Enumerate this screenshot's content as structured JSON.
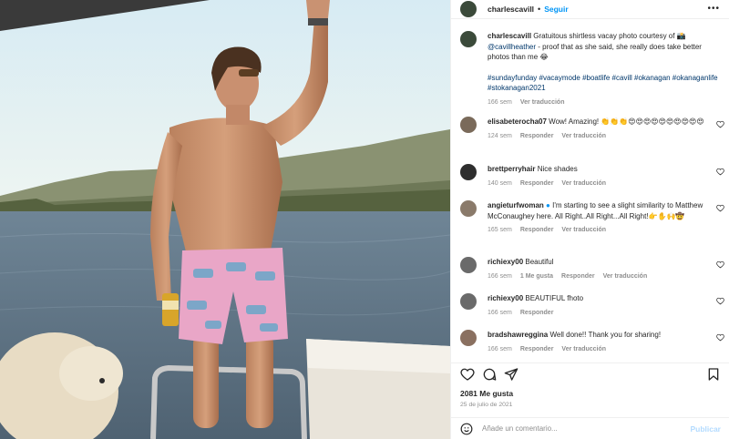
{
  "post": {
    "username": "charlescavill",
    "follow_label": "Seguir",
    "more_label": "•••",
    "caption": {
      "username": "charlescavill",
      "text": "Gratuitous shirtless vacay photo courtesy of 📸 ",
      "mention": "@cavillheather",
      "text2": " - proof that as she said, she really does take better photos than me 😂",
      "hashtags": "#sundayfunday #vacaymode #boatlife #cavill #okanagan #okanaganlife #stokanagan2021",
      "time": "166 sem",
      "translate": "Ver traducción"
    },
    "comments": [
      {
        "user": "elisabeterocha07",
        "text": "Wow! Amazing! 👏👏👏😍😍😍😍😍😍😍😍😍😍",
        "time": "124 sem",
        "reply": "Responder",
        "translate": "Ver traducción",
        "likes": ""
      },
      {
        "user": "brettperryhair",
        "text": "Nice shades",
        "time": "140 sem",
        "reply": "Responder",
        "translate": "Ver traducción",
        "likes": ""
      },
      {
        "user": "angieturfwoman",
        "text": "I'm starting to see a slight similarity to Matthew McConaughey here. All Right..All Right...All Right!👉✋🙌🤠",
        "time": "165 sem",
        "reply": "Responder",
        "translate": "Ver traducción",
        "likes": ""
      },
      {
        "user": "richiexy00",
        "text": "Beautiful",
        "time": "166 sem",
        "reply": "Responder",
        "translate": "Ver traducción",
        "likes": "1 Me gusta"
      },
      {
        "user": "richiexy00",
        "text": "BEAUTIFUL fhoto",
        "time": "166 sem",
        "reply": "Responder",
        "translate": "",
        "likes": ""
      },
      {
        "user": "bradshawreggina",
        "text": "Well done!! Thank you for sharing!",
        "time": "166 sem",
        "reply": "Responder",
        "translate": "Ver traducción",
        "likes": ""
      }
    ],
    "likes": "2081 Me gusta",
    "date": "25 de julio de 2021",
    "comment_placeholder": "Añade un comentario...",
    "publish_label": "Publicar"
  },
  "icons": {
    "like": "heart-icon",
    "comment": "comment-icon",
    "share": "share-icon",
    "save": "bookmark-icon",
    "emoji": "emoji-icon"
  },
  "colors": {
    "link": "#0095f6",
    "publish_disabled": "#b3dbff",
    "muted": "#8e8e8e"
  }
}
